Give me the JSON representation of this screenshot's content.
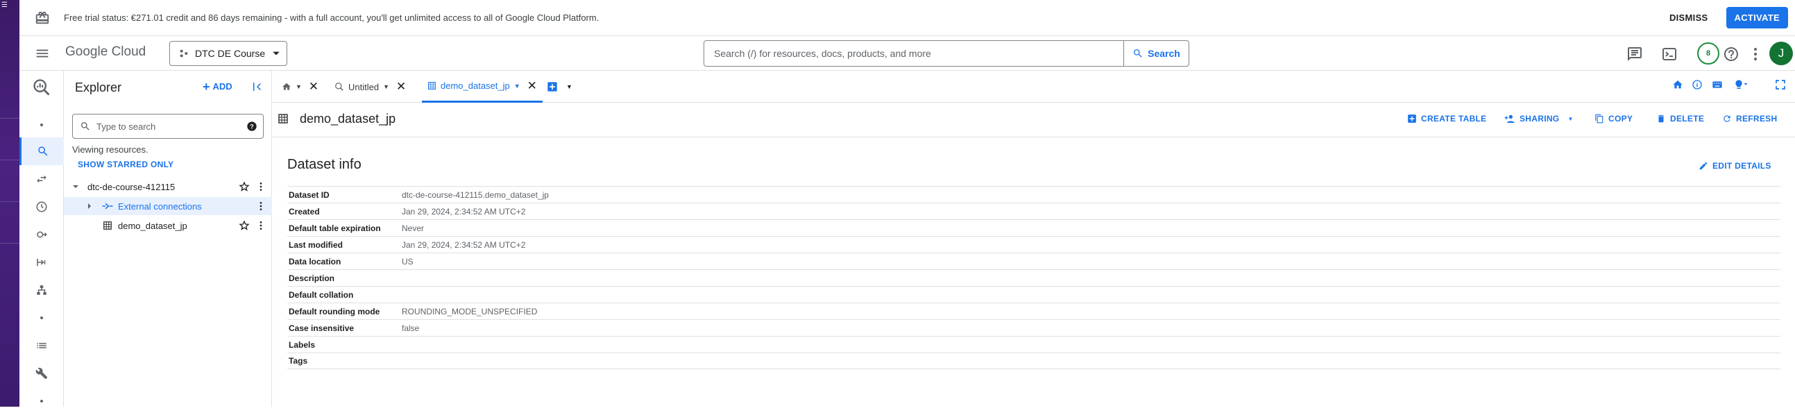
{
  "banner": {
    "message": "Free trial status: €271.01 credit and 86 days remaining - with a full account, you'll get unlimited access to all of Google Cloud Platform.",
    "dismiss_label": "DISMISS",
    "activate_label": "ACTIVATE"
  },
  "header": {
    "logo_google": "Google",
    "logo_cloud": "Cloud",
    "project_name": "DTC DE Course",
    "search_placeholder": "Search (/) for resources, docs, products, and more",
    "search_button": "Search",
    "notification_count": "8",
    "avatar_initial": "J"
  },
  "explorer": {
    "title": "Explorer",
    "add_label": "ADD",
    "search_placeholder": "Type to search",
    "viewing_text": "Viewing resources.",
    "show_starred_label": "SHOW STARRED ONLY",
    "tree": {
      "project": "dtc-de-course-412115",
      "external_connections": "External connections",
      "dataset": "demo_dataset_jp"
    }
  },
  "tabs": {
    "untitled": "Untitled",
    "dataset": "demo_dataset_jp"
  },
  "dataset_header": {
    "title": "demo_dataset_jp",
    "create_table": "CREATE TABLE",
    "sharing": "SHARING",
    "copy": "COPY",
    "delete": "DELETE",
    "refresh": "REFRESH"
  },
  "dataset_info": {
    "title": "Dataset info",
    "edit_details": "EDIT DETAILS",
    "rows": [
      {
        "key": "Dataset ID",
        "value": "dtc-de-course-412115.demo_dataset_jp"
      },
      {
        "key": "Created",
        "value": "Jan 29, 2024, 2:34:52 AM UTC+2"
      },
      {
        "key": "Default table expiration",
        "value": "Never"
      },
      {
        "key": "Last modified",
        "value": "Jan 29, 2024, 2:34:52 AM UTC+2"
      },
      {
        "key": "Data location",
        "value": "US"
      },
      {
        "key": "Description",
        "value": ""
      },
      {
        "key": "Default collation",
        "value": ""
      },
      {
        "key": "Default rounding mode",
        "value": "ROUNDING_MODE_UNSPECIFIED"
      },
      {
        "key": "Case insensitive",
        "value": "false"
      },
      {
        "key": "Labels",
        "value": ""
      },
      {
        "key": "Tags",
        "value": ""
      }
    ]
  },
  "colors": {
    "accent": "#1a73e8",
    "purple_strip": "#3b1a66",
    "avatar": "#137333"
  }
}
